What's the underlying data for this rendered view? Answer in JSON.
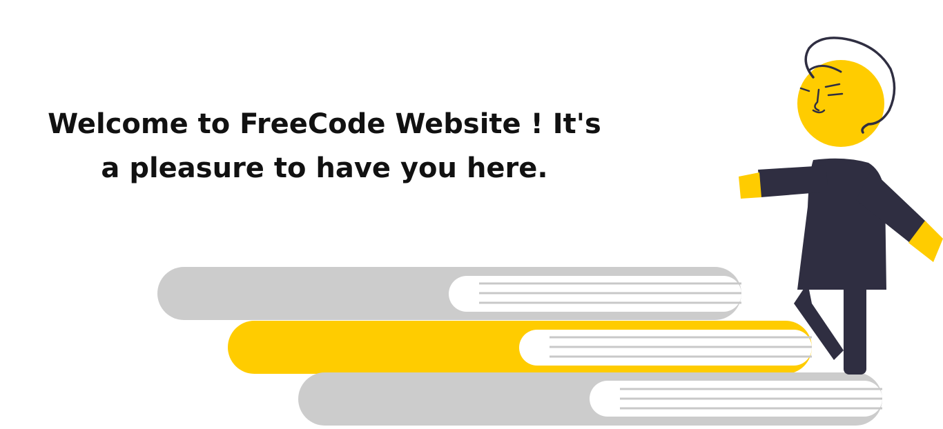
{
  "banner": {
    "line1": "Welcome to FreeCode Website ! It's",
    "line2": "a pleasure to have you here."
  },
  "illustration": {
    "name": "person-walking-on-books",
    "colors": {
      "book_gray": "#cccccc",
      "book_yellow": "#ffcc00",
      "pages": "#ffffff",
      "page_lines": "#c8c8c8",
      "skin": "#ffcc00",
      "clothes": "#2f2e41",
      "outline": "#2f2e41"
    }
  }
}
